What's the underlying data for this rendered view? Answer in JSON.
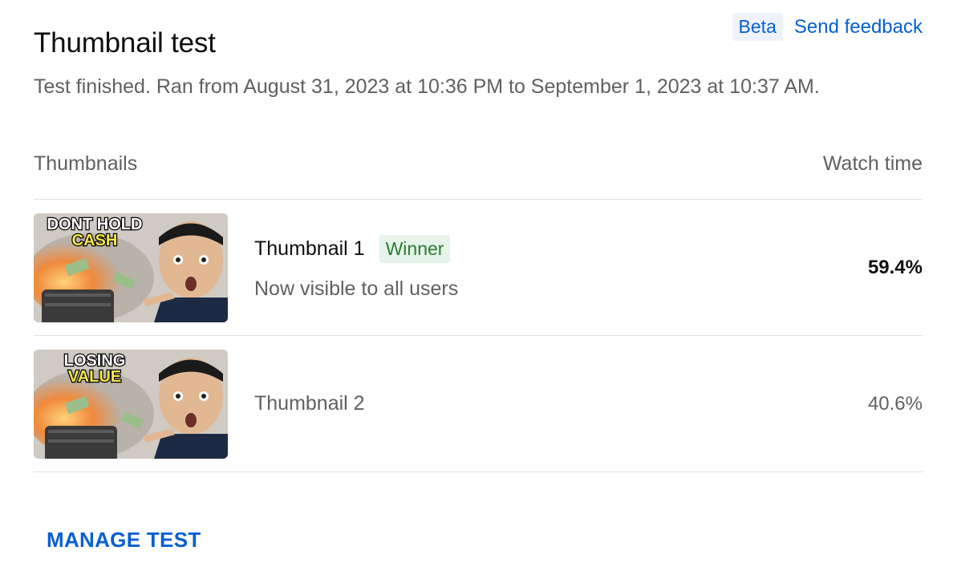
{
  "header": {
    "title": "Thumbnail test",
    "beta_label": "Beta",
    "feedback_label": "Send feedback",
    "status": "Test finished. Ran from August 31, 2023 at 10:36 PM to September 1, 2023 at 10:37 AM."
  },
  "table": {
    "col_thumbnails": "Thumbnails",
    "col_watch_time": "Watch time",
    "rows": [
      {
        "name": "Thumbnail 1",
        "badge": "Winner",
        "note": "Now visible to all users",
        "watch_time": "59.4%",
        "image_text_line1": "DONT HOLD",
        "image_text_line2": "CASH"
      },
      {
        "name": "Thumbnail 2",
        "watch_time": "40.6%",
        "image_text_line1": "LOSING",
        "image_text_line2": "VALUE"
      }
    ]
  },
  "footer": {
    "manage_label": "MANAGE TEST"
  },
  "colors": {
    "link": "#065fd4",
    "winner_bg": "#e6f4ea",
    "winner_text": "#2e7d32",
    "muted_text": "#606060"
  }
}
